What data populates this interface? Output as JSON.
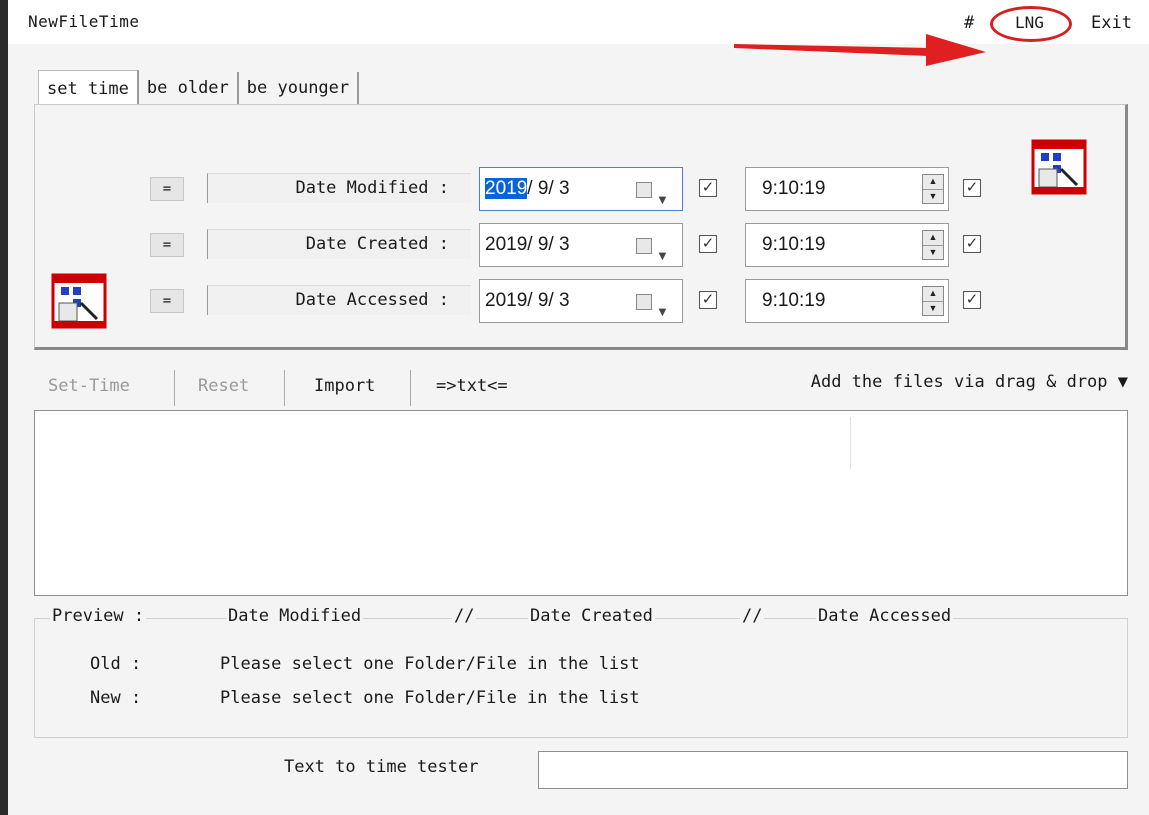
{
  "window": {
    "title": "NewFileTime",
    "menu": {
      "hash": "#",
      "lng": "LNG",
      "exit": "Exit"
    },
    "annotation_color": "#d81e1e"
  },
  "tabs": [
    {
      "label": "set time",
      "active": true
    },
    {
      "label": "be older",
      "active": false
    },
    {
      "label": "be younger",
      "active": false
    }
  ],
  "time_rows": [
    {
      "eq": "=",
      "label": "Date Modified :",
      "date_year": "2019",
      "date_rest": "/ 9/ 3",
      "time": "9:10:19",
      "date_checked": true,
      "time_checked": true
    },
    {
      "eq": "=",
      "label": "Date Created :",
      "date_year": "2019",
      "date_rest": "/ 9/ 3",
      "time": "9:10:19",
      "date_checked": true,
      "time_checked": true
    },
    {
      "eq": "=",
      "label": "Date Accessed :",
      "date_year": "2019",
      "date_rest": "/ 9/ 3",
      "time": "9:10:19",
      "date_checked": true,
      "time_checked": true
    }
  ],
  "toolbar": {
    "set_time": "Set-Time",
    "reset": "Reset",
    "import": "Import",
    "txt": "=>txt<=",
    "dragdrop": "Add the files via drag & drop ▼"
  },
  "preview": {
    "label": "Preview  :",
    "col1": "Date Modified",
    "sep1": "//",
    "col2": "Date Created",
    "sep2": "//",
    "col3": "Date Accessed",
    "old_label": "Old :",
    "new_label": "New :",
    "old_text": "Please select one Folder/File in the list",
    "new_text": "Please select one Folder/File in the list"
  },
  "tester": {
    "label": "Text to time tester",
    "value": ""
  },
  "colors": {
    "selection": "#0a64d8",
    "focus_border": "#4a7fd6"
  },
  "icons": [
    "calendar-clock-icon",
    "calendar-dropdown-icon",
    "spin-updown-icon",
    "check-icon"
  ]
}
